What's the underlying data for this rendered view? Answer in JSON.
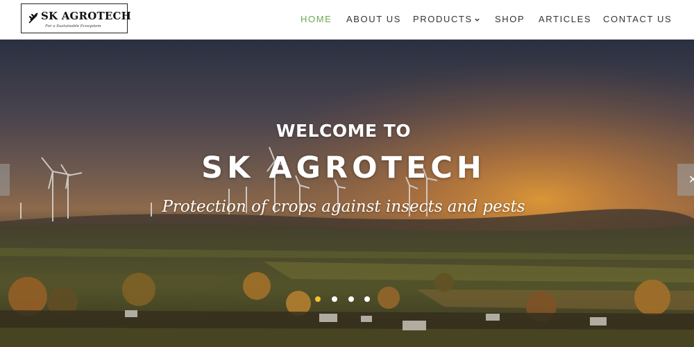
{
  "brand": {
    "name": "SK AGROTECH",
    "tagline": "For a Sustainable Ecosystem"
  },
  "nav": {
    "items": [
      {
        "label": "HOME",
        "active": true
      },
      {
        "label": "ABOUT US",
        "active": false
      },
      {
        "label": "PRODUCTS",
        "active": false,
        "has_dropdown": true
      },
      {
        "label": "SHOP",
        "active": false
      },
      {
        "label": "ARTICLES",
        "active": false
      },
      {
        "label": "CONTACT US",
        "active": false
      }
    ]
  },
  "hero": {
    "kicker": "WELCOME TO",
    "title": "SK AGROTECH",
    "subtitle": "Protection of crops against insects and pests",
    "slides": {
      "count": 4,
      "active_index": 0
    }
  },
  "icons": {
    "logo": "wheat-icon",
    "dropdown": "chevron-down-icon",
    "next": "arrow-right-icon",
    "prev": "arrow-left-icon"
  },
  "colors": {
    "active_nav": "#6aa84f",
    "nav_text": "#333333",
    "active_dot": "#f1c232"
  }
}
